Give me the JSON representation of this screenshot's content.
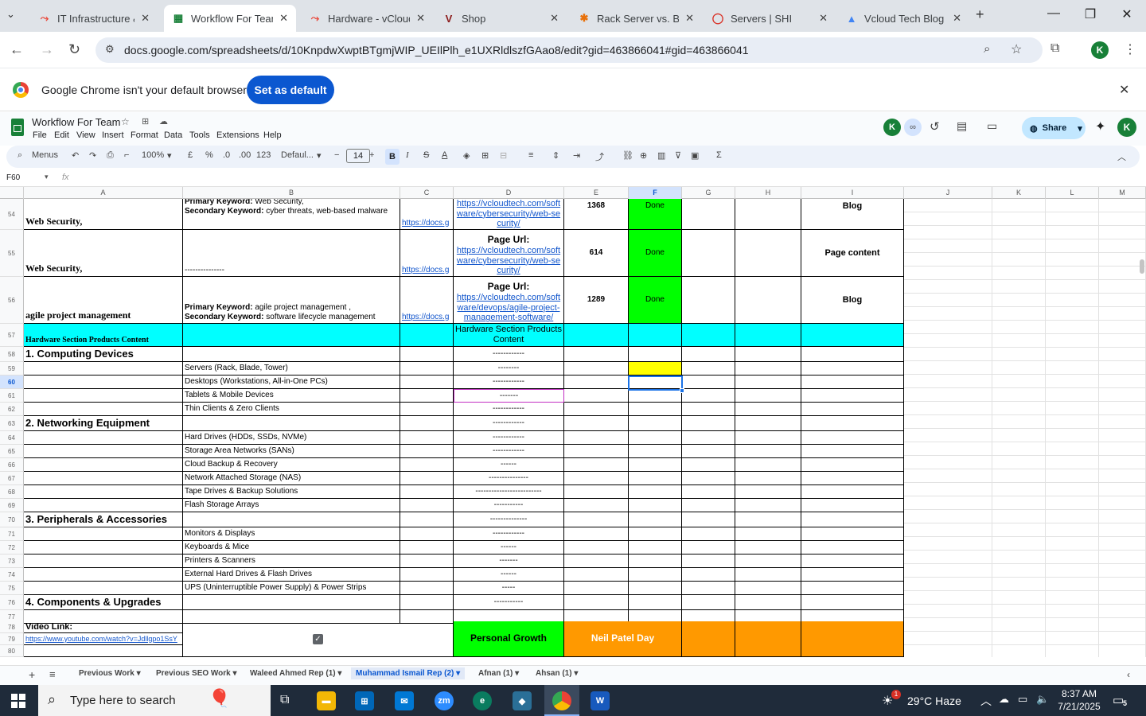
{
  "browser": {
    "tabs": [
      {
        "title": "IT Infrastructure &",
        "color": "#ea4335",
        "glyph": "⤳"
      },
      {
        "title": "Workflow For Team",
        "color": "#188038",
        "glyph": "▦"
      },
      {
        "title": "Hardware - vCloud",
        "color": "#ea4335",
        "glyph": "⤳"
      },
      {
        "title": "Shop",
        "color": "#8b1a1a",
        "glyph": "V"
      },
      {
        "title": "Rack Server vs. Bla",
        "color": "#e8710a",
        "glyph": "✱"
      },
      {
        "title": "Servers | SHI",
        "color": "#d93025",
        "glyph": "◯"
      },
      {
        "title": "Vcloud Tech Blog",
        "color": "#4285f4",
        "glyph": "▲"
      }
    ],
    "url": "docs.google.com/spreadsheets/d/10KnpdwXwptBTgmjWIP_UEIlPlh_e1UXRldlszfGAao8/edit?gid=463866041#gid=463866041",
    "infobar_text": "Google Chrome isn't your default browser",
    "set_default_label": "Set as default",
    "profile_initial": "K"
  },
  "sheets": {
    "doc_title": "Workflow For Team",
    "menus": [
      "File",
      "Edit",
      "View",
      "Insert",
      "Format",
      "Data",
      "Tools",
      "Extensions",
      "Help"
    ],
    "share_label": "Share",
    "toolbar": {
      "menus": "Menus",
      "zoom": "100%",
      "currency": "£",
      "percent": "%",
      "dec_less": ".0",
      "dec_more": ".00",
      "num_fmt": "123",
      "font": "Defaul...",
      "font_size": "14",
      "bold": "B",
      "italic": "I",
      "strike": "S",
      "text_color": "A"
    },
    "name_box": "F60",
    "fx": "fx",
    "columns": [
      "A",
      "B",
      "C",
      "D",
      "E",
      "F",
      "G",
      "H",
      "I",
      "J",
      "K",
      "L",
      "M"
    ],
    "rows": {
      "r54": {
        "num": "54",
        "a": "Web Security,",
        "b1": "Primary Keyword:",
        "b1v": " Web Security,",
        "b2": "Secondary Keyword:",
        "b2v": " cyber threats, web-based malware",
        "c": "https://docs.g",
        "d": "https://vcloudtech.com/software/cybersecurity/web-security/",
        "e": "1368",
        "f": "Done",
        "i": "Blog"
      },
      "r55": {
        "num": "55",
        "a": "Web Security,",
        "b": "---------------",
        "c": "https://docs.g",
        "d_label": "Page Url:",
        "d": "https://vcloudtech.com/software/cybersecurity/web-security/",
        "e": "614",
        "f": "Done",
        "i": "Page content"
      },
      "r56": {
        "num": "56",
        "a": "agile project management",
        "b1": "Primary Keyword:",
        "b1v": "  agile project management ,",
        "b2": "Secondary Keyword:",
        "b2v": "  software lifecycle management",
        "c": "https://docs.g",
        "d_label": "Page Url:",
        "d": "https://vcloudtech.com/software/devops/agile-project-management-software/",
        "e": "1289",
        "f": "Done",
        "i": "Blog"
      },
      "r57": {
        "num": "57",
        "a": "Hardware Section Products Content",
        "d": "Hardware Section Products Content"
      },
      "list": [
        {
          "num": "58",
          "a": "1. Computing Devices",
          "b": "",
          "d": "------------"
        },
        {
          "num": "59",
          "a": "",
          "b": "Servers (Rack, Blade, Tower)",
          "d": "--------"
        },
        {
          "num": "60",
          "a": "",
          "b": "Desktops (Workstations, All-in-One PCs)",
          "d": "------------"
        },
        {
          "num": "61",
          "a": "",
          "b": "Tablets & Mobile Devices",
          "d": "-------"
        },
        {
          "num": "62",
          "a": "",
          "b": "Thin Clients & Zero Clients",
          "d": "------------"
        },
        {
          "num": "63",
          "a": "2. Networking Equipment",
          "b": "",
          "d": "------------"
        },
        {
          "num": "64",
          "a": "",
          "b": "Hard Drives (HDDs, SSDs, NVMe)",
          "d": "------------"
        },
        {
          "num": "65",
          "a": "",
          "b": "Storage Area Networks (SANs)",
          "d": "------------"
        },
        {
          "num": "66",
          "a": "",
          "b": "Cloud Backup & Recovery",
          "d": "------"
        },
        {
          "num": "67",
          "a": "",
          "b": "Network Attached Storage (NAS)",
          "d": "---------------"
        },
        {
          "num": "68",
          "a": "",
          "b": "Tape Drives & Backup Solutions",
          "d": "-------------------------"
        },
        {
          "num": "69",
          "a": "",
          "b": "Flash Storage Arrays",
          "d": "-----------"
        },
        {
          "num": "70",
          "a": "3. Peripherals & Accessories",
          "b": "",
          "d": "--------------"
        },
        {
          "num": "71",
          "a": "",
          "b": "Monitors & Displays",
          "d": "------------"
        },
        {
          "num": "72",
          "a": "",
          "b": "Keyboards & Mice",
          "d": "------"
        },
        {
          "num": "73",
          "a": "",
          "b": "Printers & Scanners",
          "d": "-------"
        },
        {
          "num": "74",
          "a": "",
          "b": "External Hard Drives & Flash Drives",
          "d": "------"
        },
        {
          "num": "75",
          "a": "",
          "b": "UPS (Uninterruptible Power Supply) & Power Strips",
          "d": "-----"
        },
        {
          "num": "76",
          "a": "4. Components & Upgrades",
          "b": "",
          "d": "-----------"
        },
        {
          "num": "77",
          "a": "",
          "b": "",
          "d": ""
        }
      ],
      "r78": {
        "num": "78",
        "a": "Video Link:"
      },
      "r79": {
        "num": "79",
        "a": "https://www.youtube.com/watch?v=Jdllgpo1SsY",
        "d": "Personal Growth",
        "e": "Neil Patel Day"
      },
      "r80": {
        "num": "80"
      }
    },
    "sheet_tabs": [
      "Previous Work",
      "Previous SEO Work",
      "Waleed Ahmed Rep (1)",
      "Muhammad Ismail Rep (2)",
      "Afnan (1)",
      "Ahsan (1)"
    ],
    "active_sheet": "Muhammad Ismail Rep (2)"
  },
  "taskbar": {
    "search_placeholder": "Type here to search",
    "weather": "29°C  Haze",
    "time": "8:37 AM",
    "date": "7/21/2025",
    "notif_count": "5",
    "weather_badge": "1"
  }
}
